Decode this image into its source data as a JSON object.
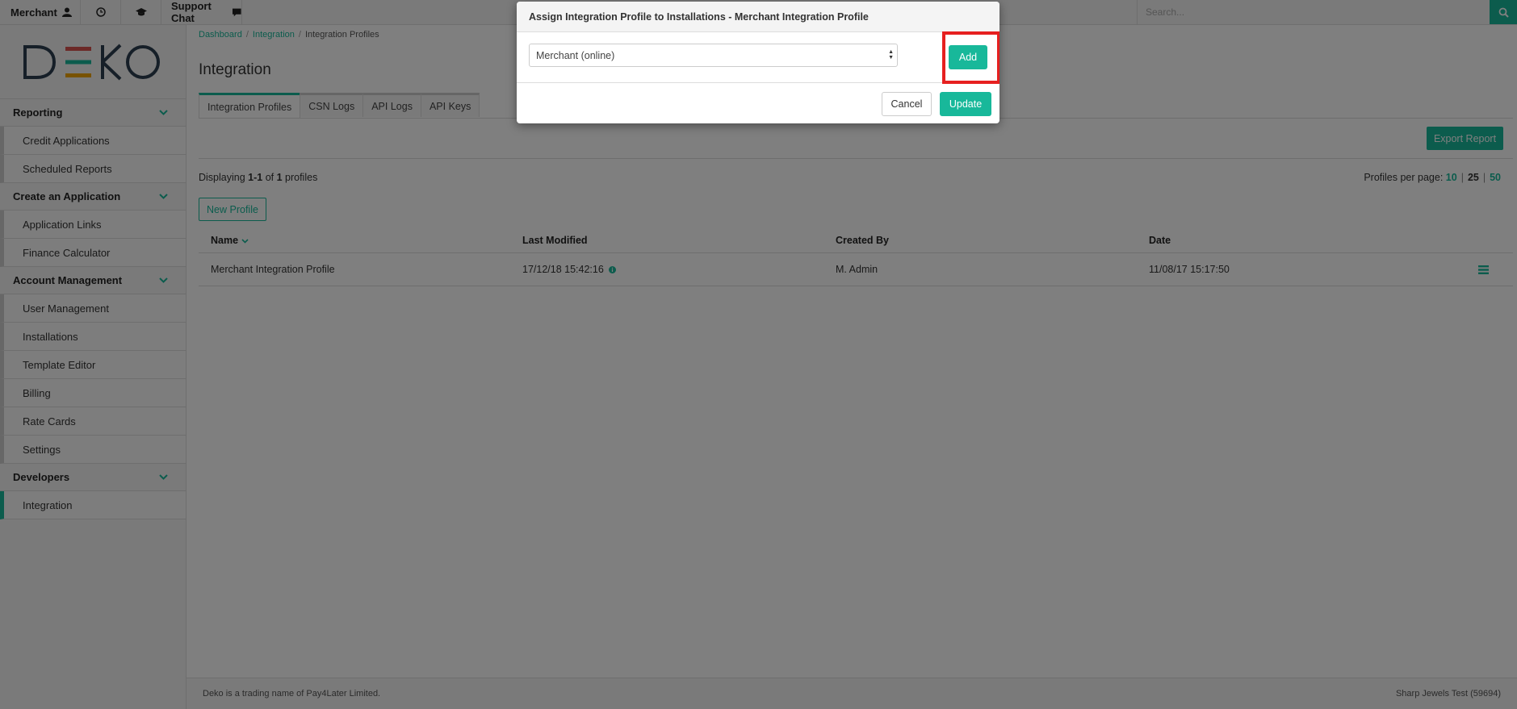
{
  "topbar": {
    "merchant_label": "Merchant",
    "support_chat_label": "Support Chat",
    "search_placeholder": "Search..."
  },
  "logo": {
    "text": "DEKO"
  },
  "sidebar": {
    "groups": [
      {
        "label": "Reporting",
        "items": [
          "Credit Applications",
          "Scheduled Reports"
        ]
      },
      {
        "label": "Create an Application",
        "items": [
          "Application Links",
          "Finance Calculator"
        ]
      },
      {
        "label": "Account Management",
        "items": [
          "User Management",
          "Installations",
          "Template Editor",
          "Billing",
          "Rate Cards",
          "Settings"
        ]
      },
      {
        "label": "Developers",
        "items": [
          "Integration"
        ]
      }
    ]
  },
  "breadcrumb": [
    "Dashboard",
    "Integration",
    "Integration Profiles"
  ],
  "page_title": "Integration",
  "tabs": [
    "Integration Profiles",
    "CSN Logs",
    "API Logs",
    "API Keys"
  ],
  "export_button": "Export Report",
  "displaying": {
    "prefix": "Displaying ",
    "range": "1-1",
    "of": " of ",
    "total": "1",
    "suffix": " profiles"
  },
  "per_page": {
    "label": "Profiles per page: ",
    "options": [
      "10",
      "25",
      "50"
    ]
  },
  "new_profile_button": "New Profile",
  "table": {
    "headers": [
      "Name",
      "Last Modified",
      "Created By",
      "Date"
    ],
    "rows": [
      {
        "name": "Merchant Integration Profile",
        "last_modified": "17/12/18 15:42:16",
        "created_by": "M. Admin",
        "date": "11/08/17 15:17:50"
      }
    ]
  },
  "footer": {
    "left": "Deko is a trading name of Pay4Later Limited.",
    "right": "Sharp Jewels Test (59694)"
  },
  "modal": {
    "title": "Assign Integration Profile to Installations - Merchant Integration Profile",
    "select_value": "Merchant (online)",
    "add_button": "Add",
    "cancel_button": "Cancel",
    "update_button": "Update"
  },
  "colors": {
    "accent": "#18b89a",
    "highlight": "#e62020"
  }
}
